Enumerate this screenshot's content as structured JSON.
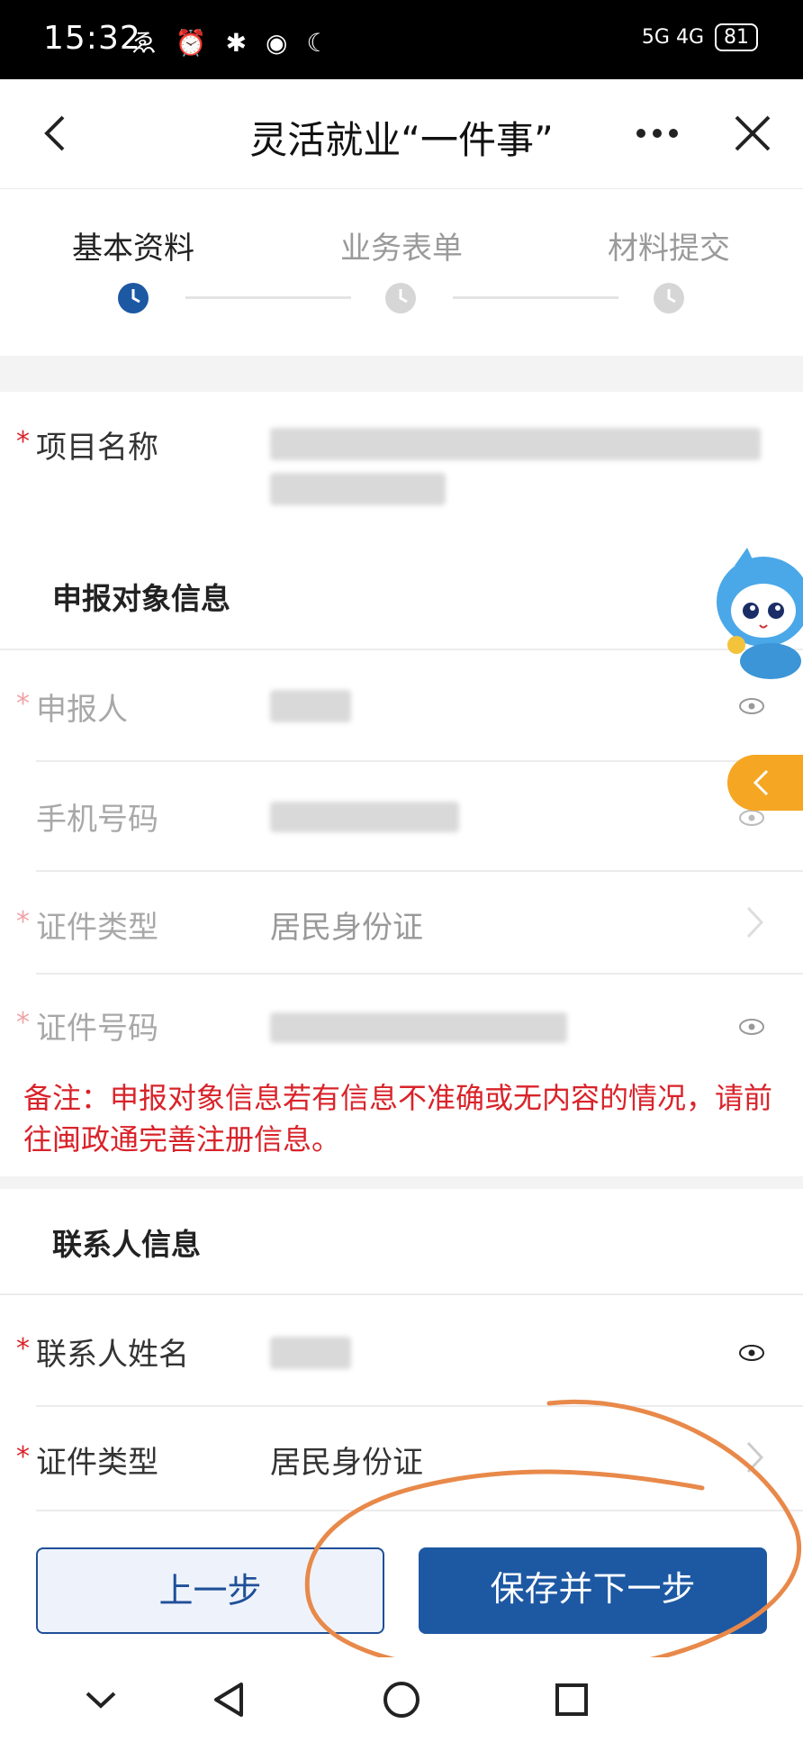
{
  "status_bar": {
    "time": "15:32",
    "left_icons": "ゑ ⏰ ✱ ◉ ☾",
    "network": "5G  4G",
    "battery": "81"
  },
  "title_bar": {
    "title": "灵活就业“一件事”"
  },
  "steps": [
    {
      "label": "基本资料",
      "state": "active"
    },
    {
      "label": "业务表单",
      "state": "pending"
    },
    {
      "label": "材料提交",
      "state": "pending"
    }
  ],
  "project": {
    "label": "项目名称"
  },
  "applicant_section": {
    "title": "申报对象信息",
    "fields": [
      {
        "label": "申报人",
        "required": true,
        "value": ""
      },
      {
        "label": "手机号码",
        "required": false,
        "value": ""
      },
      {
        "label": "证件类型",
        "required": true,
        "value": "居民身份证"
      },
      {
        "label": "证件号码",
        "required": true,
        "value": ""
      }
    ],
    "note": "备注：申报对象信息若有信息不准确或无内容的情况，请前往闽政通完善注册信息。"
  },
  "contact_section": {
    "title": "联系人信息",
    "fields": [
      {
        "label": "联系人姓名",
        "required": true,
        "value": ""
      },
      {
        "label": "证件类型",
        "required": true,
        "value": "居民身份证"
      }
    ]
  },
  "buttons": {
    "prev": "上一步",
    "next": "保存并下一步"
  },
  "colors": {
    "primary": "#1d58a3",
    "required": "#d9232a",
    "float_tab": "#f5a623",
    "annotation": "#e8894a"
  },
  "icons": [
    "back-icon",
    "more-icon",
    "close-icon",
    "clock-icon",
    "eye-icon",
    "chevron-right-icon",
    "nav-down-icon",
    "nav-back-icon",
    "nav-home-icon",
    "nav-recents-icon"
  ]
}
